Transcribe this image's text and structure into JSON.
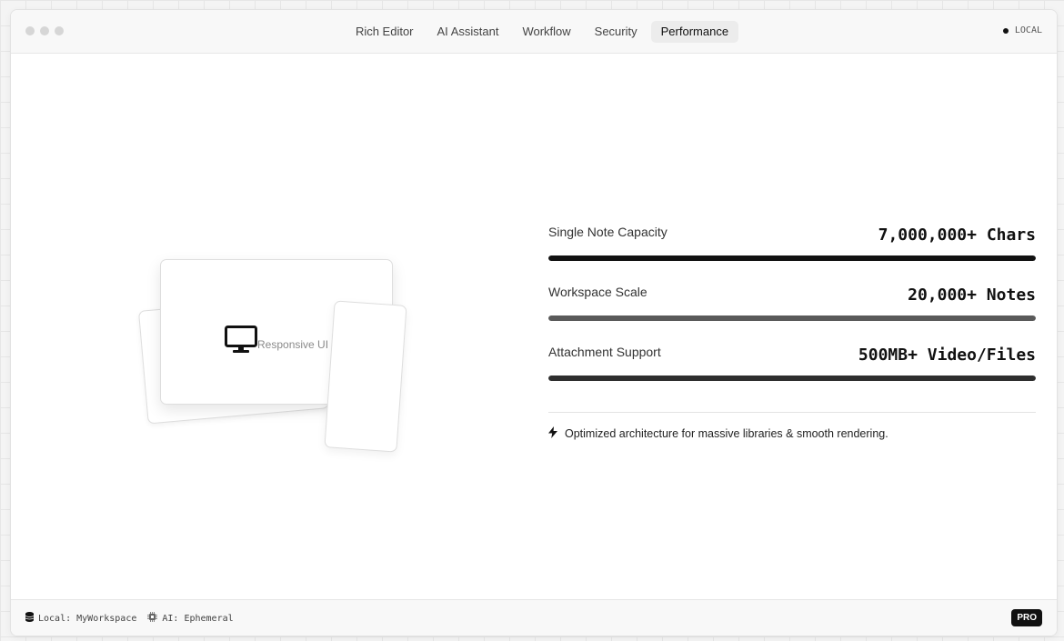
{
  "titlebar": {
    "tabs": [
      {
        "label": "Rich Editor",
        "active": false
      },
      {
        "label": "AI Assistant",
        "active": false
      },
      {
        "label": "Workflow",
        "active": false
      },
      {
        "label": "Security",
        "active": false
      },
      {
        "label": "Performance",
        "active": true
      }
    ],
    "mode_badge": "LOCAL"
  },
  "illustration": {
    "label": "Responsive UI",
    "icon": "monitor-icon"
  },
  "metrics": [
    {
      "label": "Single Note Capacity",
      "value": "7,000,000+ Chars",
      "level": 1.0,
      "color": "#111111"
    },
    {
      "label": "Workspace Scale",
      "value": "20,000+ Notes",
      "level": 1.0,
      "color": "#5a5a5a"
    },
    {
      "label": "Attachment Support",
      "value": "500MB+ Video/Files",
      "level": 1.0,
      "color": "#2e2e2e"
    }
  ],
  "note": {
    "icon": "lightning-icon",
    "text": "Optimized architecture for massive libraries & smooth rendering."
  },
  "statusbar": {
    "storage": "Local: MyWorkspace",
    "storage_icon": "database-icon",
    "ai": "AI: Ephemeral",
    "ai_icon": "chip-icon",
    "plan": "PRO"
  }
}
